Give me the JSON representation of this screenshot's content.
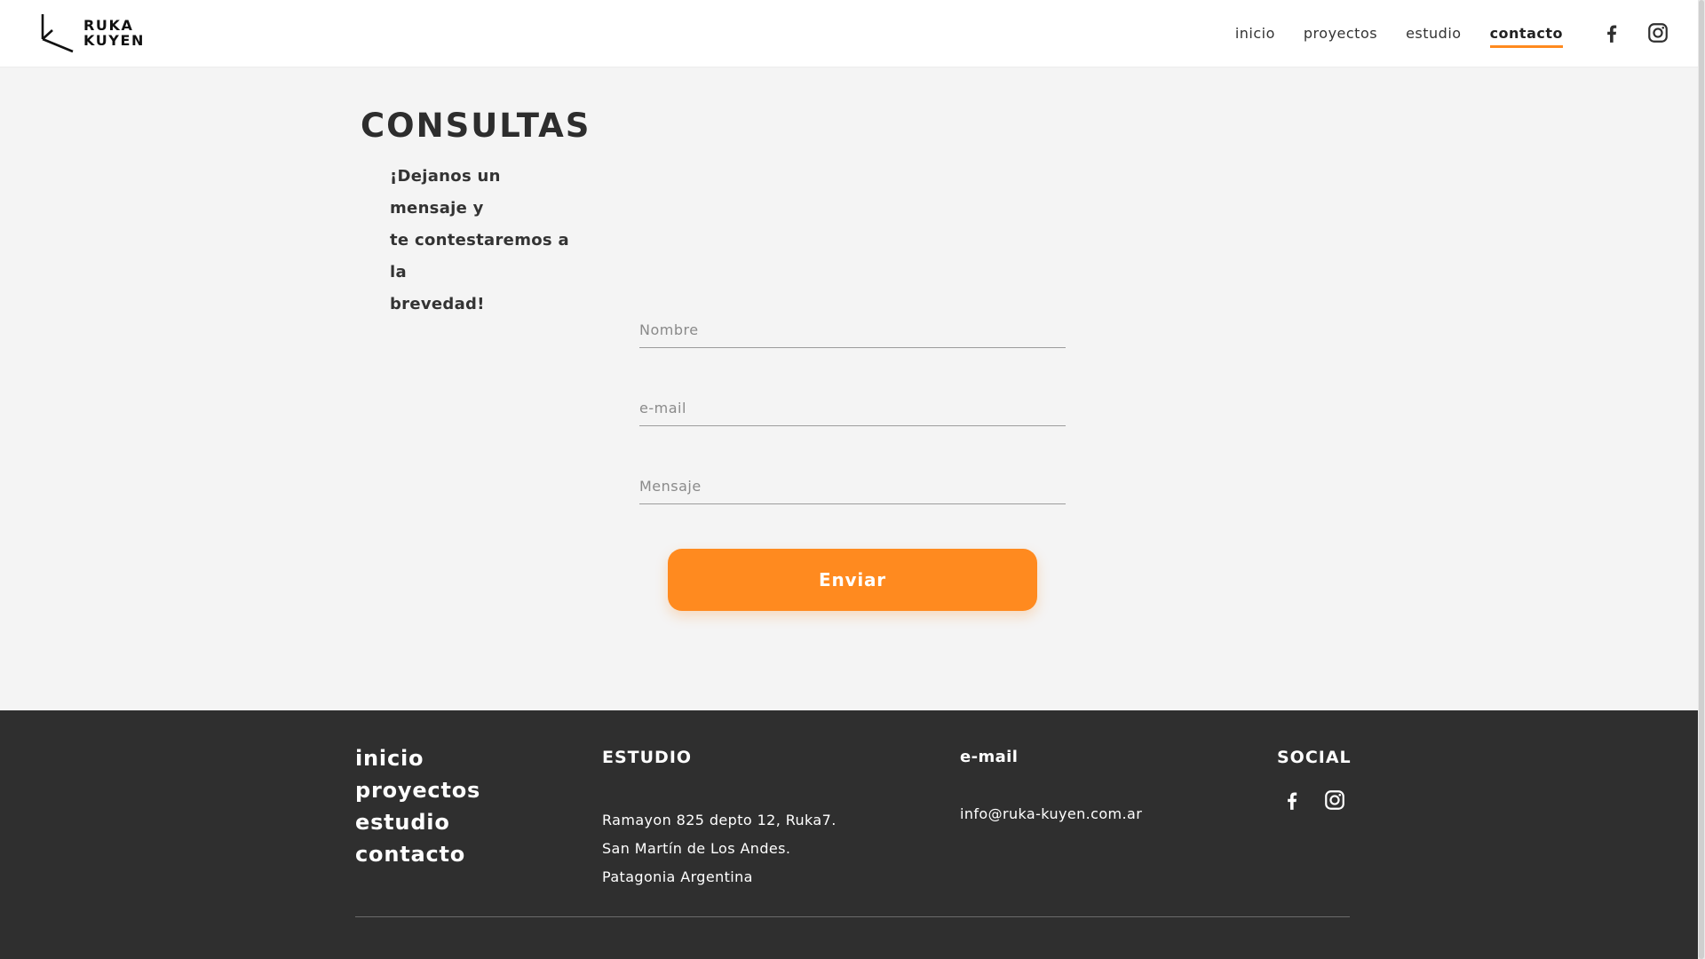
{
  "header": {
    "logo": {
      "line1": "RUKA",
      "line2": "KUYEN"
    },
    "nav": [
      {
        "label": "inicio"
      },
      {
        "label": "proyectos"
      },
      {
        "label": "estudio"
      },
      {
        "label": "contacto",
        "active": true
      }
    ],
    "social": [
      {
        "icon": "facebook-icon"
      },
      {
        "icon": "instagram-icon"
      }
    ]
  },
  "main": {
    "title": "CONSULTAS",
    "subtitle_lines": [
      "¡Dejanos un mensaje y",
      "te contestaremos a la",
      "brevedad!"
    ],
    "form": {
      "name_placeholder": "Nombre",
      "email_placeholder": "e-mail",
      "message_placeholder": "Mensaje",
      "submit_label": "Enviar"
    }
  },
  "footer": {
    "nav": [
      "inicio",
      "proyectos",
      "estudio",
      "contacto"
    ],
    "studio": {
      "title": "ESTUDIO",
      "lines": [
        "Ramayon 825 depto 12, Ruka7.",
        "San Martín de Los Andes.",
        "Patagonia Argentina"
      ]
    },
    "email": {
      "title": "e-mail",
      "address": "info@ruka-kuyen.com.ar"
    },
    "social": {
      "title": "SOCIAL",
      "icons": [
        "facebook-icon",
        "instagram-icon"
      ]
    }
  },
  "colors": {
    "accent": "#ff8a1f",
    "background": "#f4f4f4",
    "footer": "#2f2f2f",
    "text": "#2f2f2f"
  }
}
